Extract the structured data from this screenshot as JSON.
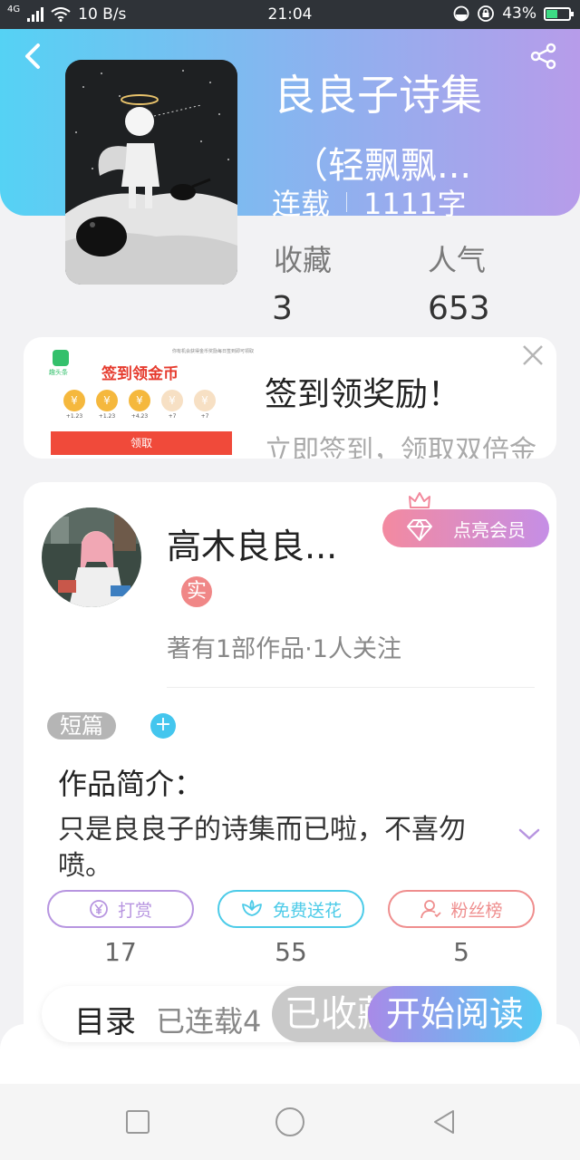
{
  "status_bar": {
    "network": "4G",
    "speed": "10 B/s",
    "time": "21:04",
    "battery": "43%"
  },
  "book": {
    "title_line1": "良良子诗集",
    "title_line2": "（轻飘飘...",
    "status": "连载",
    "word_count": "1111字",
    "stats": [
      {
        "label": "收藏",
        "value": "3"
      },
      {
        "label": "人气",
        "value": "653"
      }
    ]
  },
  "ad": {
    "title": "签到领奖励！",
    "subtitle": "立即签到，领取双倍金",
    "thumb_title": "签到领金币",
    "thumb_brand": "趣头条",
    "thumb_note": "你有机会获得金币奖励每日签到即可领取",
    "thumb_coin_symbol": "¥",
    "thumb_coins": [
      "+1.23",
      "+1.23",
      "+4.23",
      "+7",
      "+7"
    ],
    "thumb_button": "领取"
  },
  "author": {
    "name": "高木良良...",
    "real_badge": "实",
    "meta": "著有1部作品·1人关注",
    "vip_label": "点亮会员"
  },
  "work": {
    "tag": "短篇",
    "add_tag": "+",
    "intro_label": "作品简介：",
    "intro_text": "只是良良子的诗集而已啦，不喜勿喷。"
  },
  "actions": [
    {
      "label": "打赏",
      "count": "17",
      "color": "#b795e0"
    },
    {
      "label": "免费送花",
      "count": "55",
      "color": "#4ccbe8"
    },
    {
      "label": "粉丝榜",
      "count": "5",
      "color": "#ef8e8e"
    }
  ],
  "bottom_bar": {
    "catalog_label": "目录",
    "catalog_status": "已连载4",
    "collected_label": "已收藏",
    "read_label": "开始阅读"
  },
  "colors": {
    "hero_gradient_start": "#55d2f4",
    "hero_gradient_end": "#b79cea",
    "accent_blue": "#44c6ee"
  }
}
